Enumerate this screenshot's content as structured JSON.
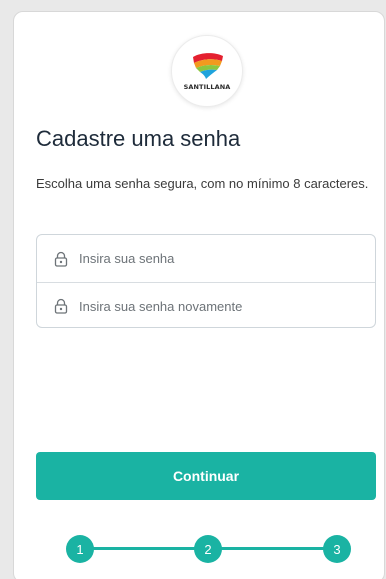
{
  "brand": {
    "logo_text": "SANTILLANA",
    "accent_color": "#1ab3a3"
  },
  "page": {
    "title": "Cadastre uma senha",
    "subtitle": "Escolha uma senha segura, com no mínimo 8 caracteres."
  },
  "form": {
    "password": {
      "placeholder": "Insira sua senha",
      "value": "",
      "icon": "lock-icon"
    },
    "password_confirm": {
      "placeholder": "Insira sua senha novamente",
      "value": "",
      "icon": "lock-icon"
    },
    "submit_label": "Continuar"
  },
  "stepper": {
    "steps": [
      "1",
      "2",
      "3"
    ]
  }
}
